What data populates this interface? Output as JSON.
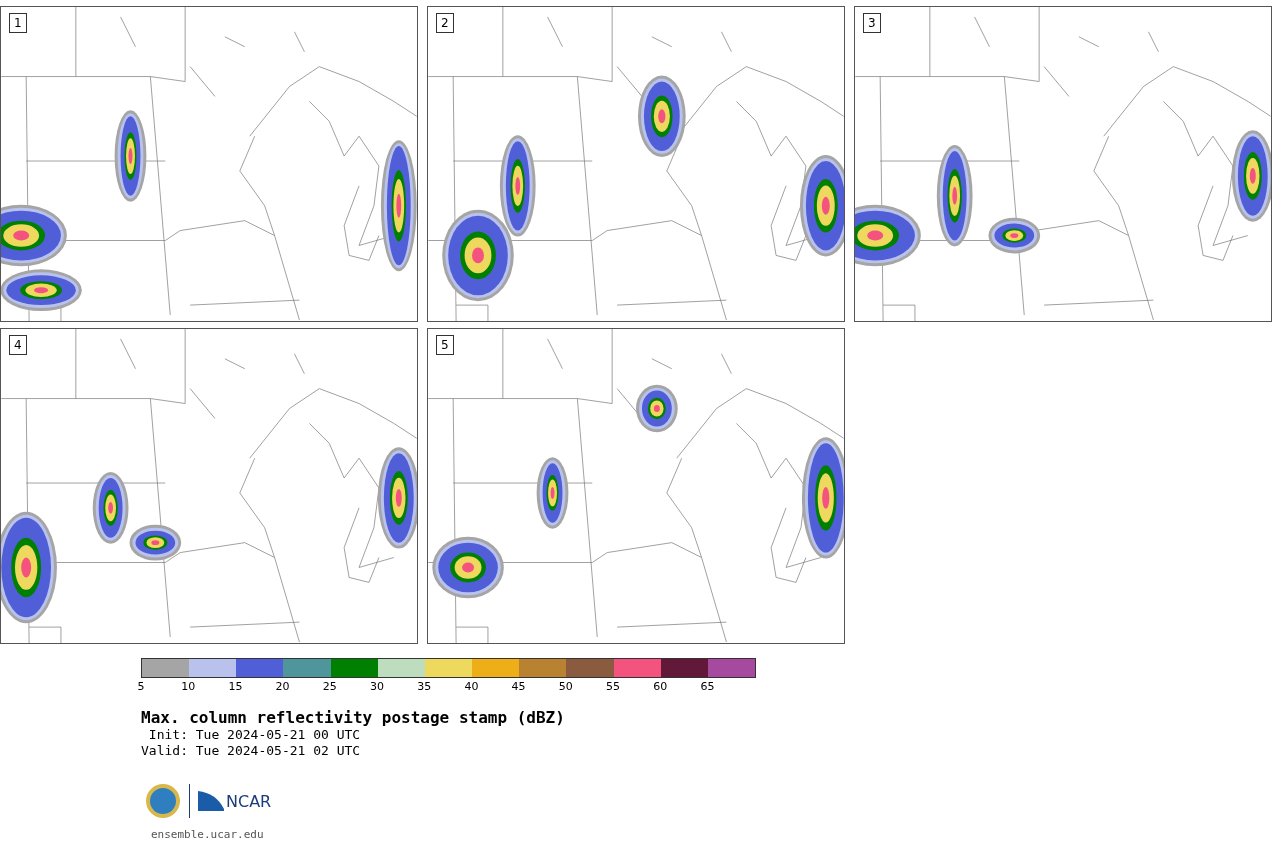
{
  "panels": [
    {
      "label": "1"
    },
    {
      "label": "2"
    },
    {
      "label": "3"
    },
    {
      "label": "4"
    },
    {
      "label": "5"
    }
  ],
  "colorbar": {
    "bins": [
      {
        "color": "#a5a5a5"
      },
      {
        "color": "#b8c2ec"
      },
      {
        "color": "#505ed8"
      },
      {
        "color": "#4e969c"
      },
      {
        "color": "#008000"
      },
      {
        "color": "#bedcbe"
      },
      {
        "color": "#eed85e"
      },
      {
        "color": "#eeae18"
      },
      {
        "color": "#b98231"
      },
      {
        "color": "#8b5b40"
      },
      {
        "color": "#f4527f"
      },
      {
        "color": "#621838"
      },
      {
        "color": "#a64a9f"
      }
    ],
    "ticks": [
      "5",
      "10",
      "15",
      "20",
      "25",
      "30",
      "35",
      "40",
      "45",
      "50",
      "55",
      "60",
      "65"
    ]
  },
  "title": "Max. column reflectivity postage stamp (dBZ)",
  "init": " Init: Tue 2024-05-21 00 UTC",
  "valid": "Valid: Tue 2024-05-21 02 UTC",
  "logo_text": "NCAR",
  "url": "ensemble.ucar.edu"
}
